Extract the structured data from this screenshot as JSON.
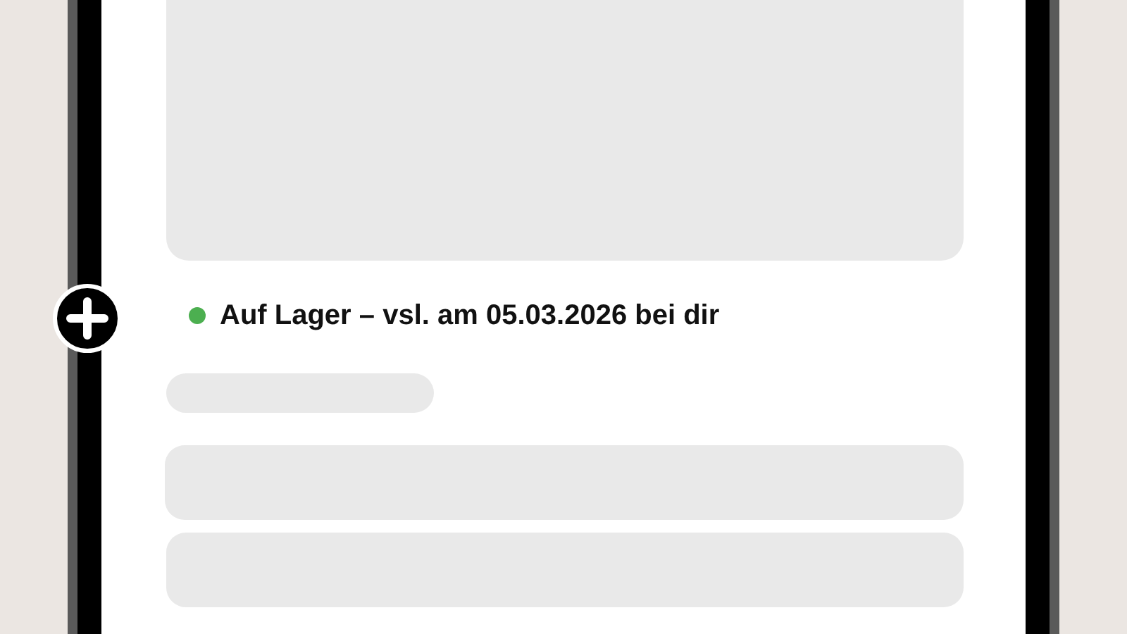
{
  "availability": {
    "color": "#4caf50",
    "text": "Auf Lager – vsl. am **05.03.2026** bei dir"
  }
}
